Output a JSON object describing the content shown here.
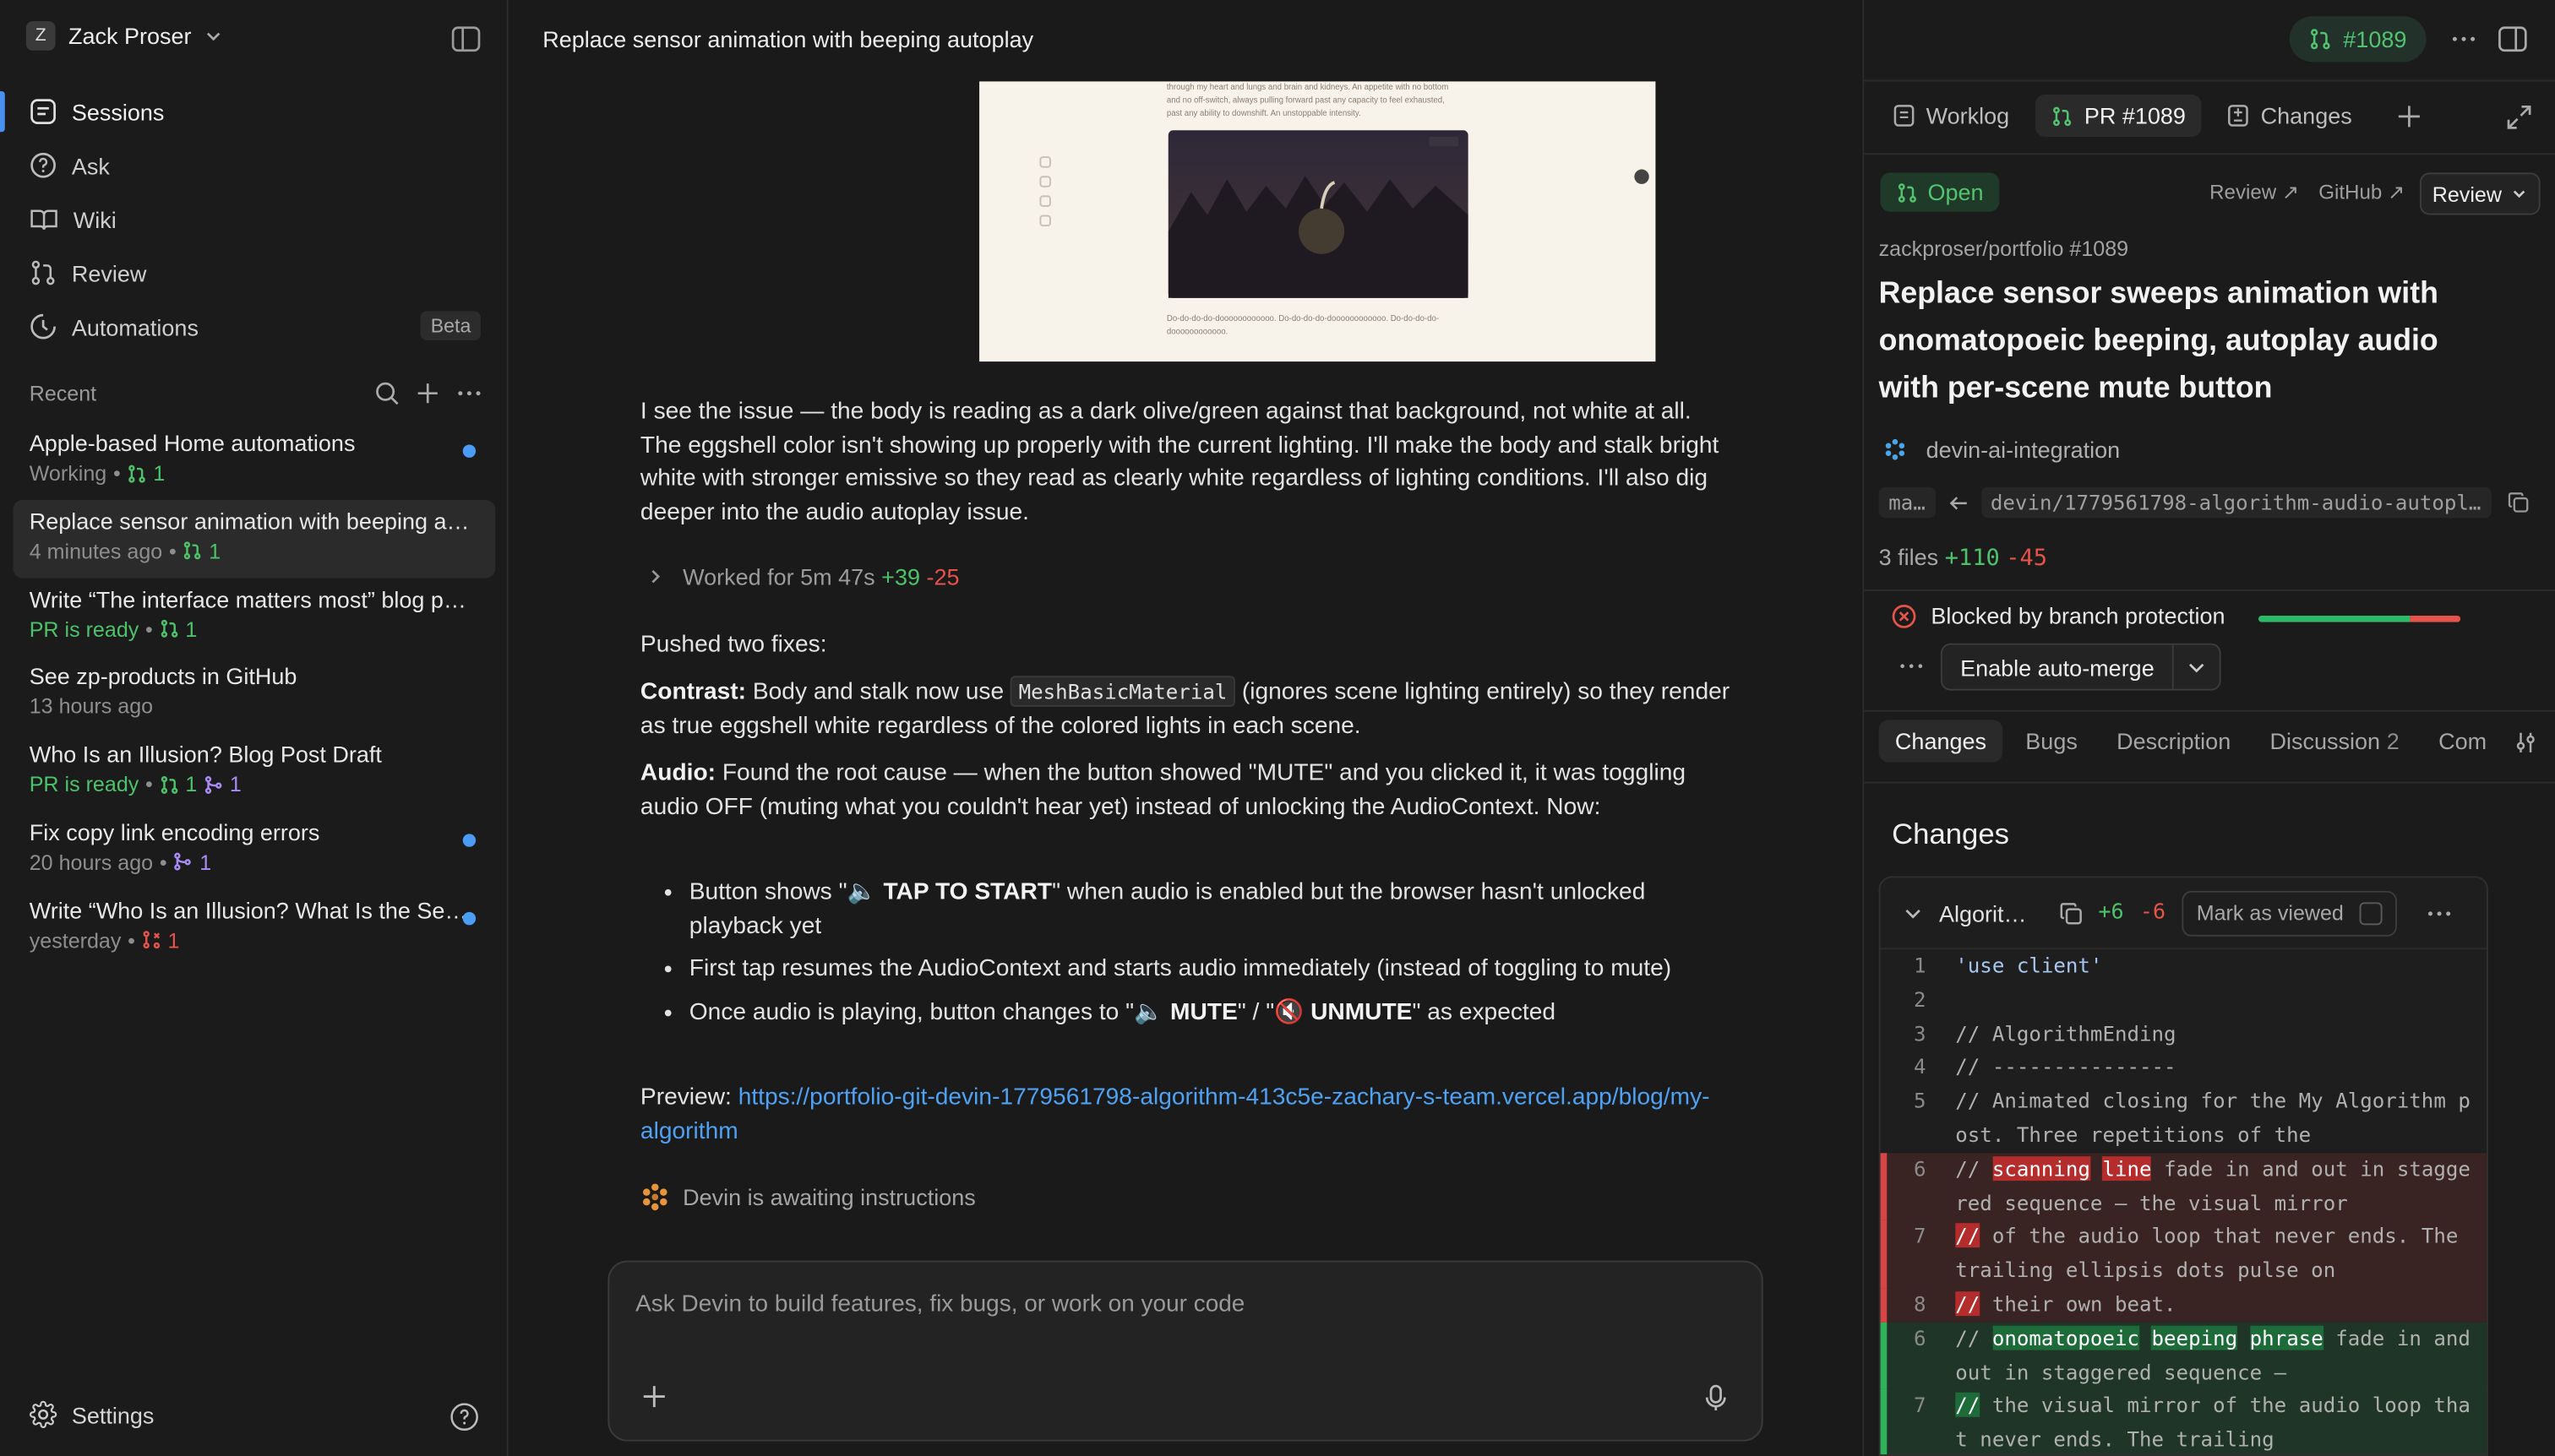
{
  "sidebar": {
    "workspace_initial": "Z",
    "workspace_name": "Zack Proser",
    "nav": [
      {
        "label": "Sessions"
      },
      {
        "label": "Ask"
      },
      {
        "label": "Wiki"
      },
      {
        "label": "Review"
      },
      {
        "label": "Automations",
        "badge": "Beta"
      }
    ],
    "recent_label": "Recent",
    "recents": [
      {
        "title": "Apple-based Home automations",
        "status": "Working",
        "count": "1"
      },
      {
        "title": "Replace sensor animation with beeping autoplay",
        "status": "4 minutes ago",
        "count": "1"
      },
      {
        "title": "Write “The interface matters most” blog post",
        "status": "PR is ready",
        "count": "1"
      },
      {
        "title": "See zp-products in GitHub",
        "status": "13 hours ago"
      },
      {
        "title": "Who Is an Illusion? Blog Post Draft",
        "status": "PR is ready",
        "count": "1",
        "count2": "1"
      },
      {
        "title": "Fix copy link encoding errors",
        "status": "20 hours ago",
        "count": "1"
      },
      {
        "title": "Write “Who Is an Illusion? What Is the Self?”",
        "status": "yesterday",
        "count": "1"
      }
    ],
    "settings_label": "Settings"
  },
  "chat": {
    "title": "Replace sensor animation with beeping autoplay",
    "screenshot_caption": "Do-do-do-do-doooooooooooo. Do-do-do-do-doooooooooooo. Do-do-do-do-doooooooooooo.",
    "message1": "I see the issue — the body is reading as a dark olive/green against that background, not white at all. The eggshell color isn't showing up properly with the current lighting. I'll make the body and stalk bright white with stronger emissive so they read as clearly white regardless of lighting conditions. I'll also dig deeper into the audio autoplay issue.",
    "worked": "Worked for 5m 47s",
    "worked_plus": "+39",
    "worked_minus": "-25",
    "pushed": "Pushed two fixes:",
    "contrast_label": "Contrast:",
    "contrast_pre": "Body and stalk now use",
    "contrast_code": "MeshBasicMaterial",
    "contrast_post": "(ignores scene lighting entirely) so they render as true eggshell white regardless of the colored lights in each scene.",
    "audio_label": "Audio:",
    "audio_text": "Found the root cause — when the button showed \"MUTE\" and you clicked it, it was toggling audio OFF (muting what you couldn't hear yet) instead of unlocking the AudioContext. Now:",
    "bullet1_pre": "Button shows \"",
    "bullet1_bold": "🔈 TAP TO START",
    "bullet1_post": "\" when audio is enabled but the browser hasn't unlocked playback yet",
    "bullet2": "First tap resumes the AudioContext and starts audio immediately (instead of toggling to mute)",
    "bullet3_pre": "Once audio is playing, button changes to \"",
    "bullet3_b1": "🔈 MUTE",
    "bullet3_mid": "\" / \"",
    "bullet3_b2": "🔇 UNMUTE",
    "bullet3_post": "\" as expected",
    "preview_label": "Preview:",
    "preview_url": "https://portfolio-git-devin-1779561798-algorithm-413c5e-zachary-s-team.vercel.app/blog/my-algorithm",
    "awaiting": "Devin is awaiting instructions",
    "composer_placeholder": "Ask Devin to build features, fix bugs, or work on your code"
  },
  "panel": {
    "pr_button": "#1089",
    "tabs": [
      "Worklog",
      "PR #1089",
      "Changes"
    ],
    "status": "Open",
    "review_link": "Review ↗",
    "github_link": "GitHub ↗",
    "review_dropdown": "Review",
    "repo": "zackproser/portfolio #1089",
    "pr_title": "Replace sensor sweeps animation with onomatopoeic beeping, autoplay audio with per-scene mute button",
    "author": "devin-ai-integration",
    "base_branch": "ma…",
    "head_branch": "devin/1779561798-algorithm-audio-autopl…",
    "files": "3 files",
    "files_plus": "+110",
    "files_minus": "-45",
    "blocked": "Blocked by branch protection",
    "checks_progress": 0.75,
    "checks_failed_fraction": 0.25,
    "automerge": "Enable auto-merge",
    "subtabs": [
      {
        "label": "Changes"
      },
      {
        "label": "Bugs"
      },
      {
        "label": "Description"
      },
      {
        "label": "Discussion",
        "count": "2"
      },
      {
        "label": "Com"
      }
    ],
    "changes_heading": "Changes",
    "file": {
      "name": "Algorit…",
      "plus": "+6",
      "minus": "-6",
      "mark_viewed": "Mark as viewed"
    },
    "diff": [
      {
        "n": "1",
        "type": "ctx",
        "text": "'use client'"
      },
      {
        "n": "2",
        "type": "ctx",
        "text": ""
      },
      {
        "n": "3",
        "type": "ctx",
        "text": "// AlgorithmEnding"
      },
      {
        "n": "4",
        "type": "ctx",
        "text": "// ---------------"
      },
      {
        "n": "5",
        "type": "ctx",
        "text": "// Animated closing for the My Algorithm post. Three repetitions of the"
      },
      {
        "n": "6",
        "type": "del",
        "pre": "// ",
        "hl": "scanning",
        "mid": " ",
        "hl2": "line",
        "post": " fade in and out in staggered sequence — the visual mirror"
      },
      {
        "n": "7",
        "type": "del",
        "hl": "//",
        "post": " of the audio loop that never ends. The trailing ellipsis dots pulse on"
      },
      {
        "n": "8",
        "type": "del",
        "hl": "//",
        "post": " their own beat."
      },
      {
        "n": "6",
        "type": "add",
        "pre": "// ",
        "hl": "onomatopoeic",
        "mid": " ",
        "hl2": "beeping",
        "mid2": " ",
        "hl3": "phrase",
        "post": " fade in and out in staggered sequence —"
      },
      {
        "n": "7",
        "type": "add",
        "hl": "//",
        "post": " the visual mirror of the audio loop that never ends. The trailing"
      }
    ]
  }
}
